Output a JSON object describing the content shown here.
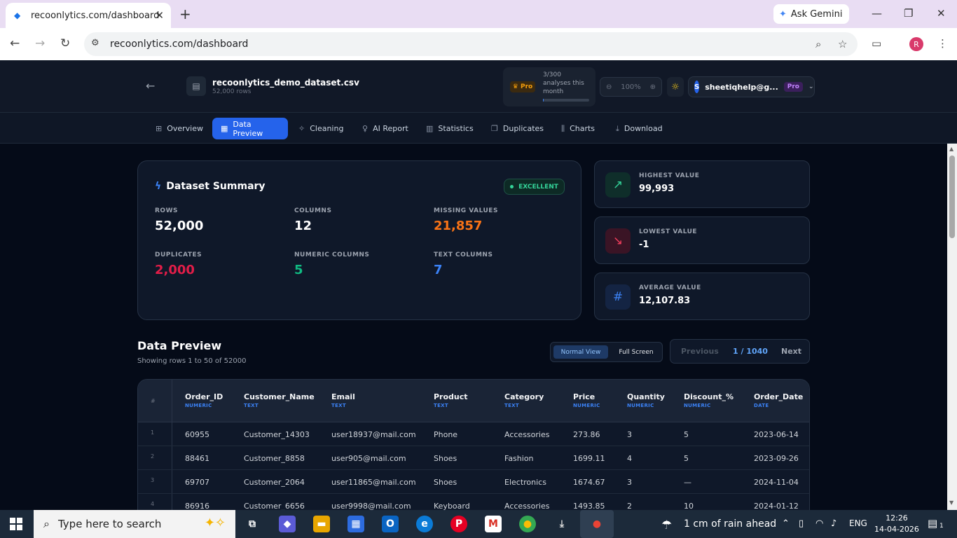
{
  "browser": {
    "tab_title": "recoonlytics.com/dashboard",
    "url": "recoonlytics.com/dashboard",
    "gemini_label": "Ask Gemini",
    "profile_initial": "R"
  },
  "header": {
    "file_name": "recoonlytics_demo_dataset.csv",
    "file_rows": "52,000 rows",
    "pro_badge": "Pro",
    "analyses_text": "3/300 analyses this month",
    "analyses_used_fraction": 0.01,
    "zoom": "100%",
    "user_initial": "S",
    "user_email": "sheetiqhelp@g...",
    "user_plan": "Pro"
  },
  "nav": {
    "tabs": [
      {
        "label": "Overview",
        "icon": "grid-icon"
      },
      {
        "label": "Data Preview",
        "icon": "table-icon",
        "active": true
      },
      {
        "label": "Cleaning",
        "icon": "sparkle-icon"
      },
      {
        "label": "AI Report",
        "icon": "bulb-icon"
      },
      {
        "label": "Statistics",
        "icon": "clipboard-icon"
      },
      {
        "label": "Duplicates",
        "icon": "copy-icon"
      },
      {
        "label": "Charts",
        "icon": "bar-chart-icon"
      },
      {
        "label": "Download",
        "icon": "download-icon"
      }
    ]
  },
  "summary": {
    "title": "Dataset Summary",
    "quality": "EXCELLENT",
    "stats": [
      {
        "label": "ROWS",
        "value": "52,000",
        "color": "#ffffff"
      },
      {
        "label": "COLUMNS",
        "value": "12",
        "color": "#ffffff"
      },
      {
        "label": "MISSING VALUES",
        "value": "21,857",
        "color": "#f97316"
      },
      {
        "label": "DUPLICATES",
        "value": "2,000",
        "color": "#e11d48"
      },
      {
        "label": "NUMERIC COLUMNS",
        "value": "5",
        "color": "#10b981"
      },
      {
        "label": "TEXT COLUMNS",
        "value": "7",
        "color": "#3b82f6"
      }
    ]
  },
  "kpis": [
    {
      "label": "HIGHEST VALUE",
      "value": "99,993",
      "icon": "trend-up-icon",
      "color": "#34d399"
    },
    {
      "label": "LOWEST VALUE",
      "value": "-1",
      "icon": "trend-down-icon",
      "color": "#f43f5e"
    },
    {
      "label": "AVERAGE VALUE",
      "value": "12,107.83",
      "icon": "hash-icon",
      "color": "#3b82f6"
    }
  ],
  "preview": {
    "title": "Data Preview",
    "subtitle": "Showing rows 1 to 50 of 52000",
    "view_normal": "Normal View",
    "view_full": "Full Screen",
    "prev_label": "Previous",
    "page": "1 / 1040",
    "next_label": "Next",
    "row_number_header": "#",
    "columns": [
      {
        "name": "Order_ID",
        "type": "NUMERIC"
      },
      {
        "name": "Customer_Name",
        "type": "TEXT"
      },
      {
        "name": "Email",
        "type": "TEXT"
      },
      {
        "name": "Product",
        "type": "TEXT"
      },
      {
        "name": "Category",
        "type": "TEXT"
      },
      {
        "name": "Price",
        "type": "NUMERIC"
      },
      {
        "name": "Quantity",
        "type": "NUMERIC"
      },
      {
        "name": "Discount_%",
        "type": "NUMERIC"
      },
      {
        "name": "Order_Date",
        "type": "DATE"
      }
    ],
    "rows": [
      {
        "n": "1",
        "cells": [
          "60955",
          "Customer_14303",
          "user18937@mail.com",
          "Phone",
          "Accessories",
          "273.86",
          "3",
          "5",
          "2023-06-14"
        ]
      },
      {
        "n": "2",
        "cells": [
          "88461",
          "Customer_8858",
          "user905@mail.com",
          "Shoes",
          "Fashion",
          "1699.11",
          "4",
          "5",
          "2023-09-26"
        ]
      },
      {
        "n": "3",
        "cells": [
          "69707",
          "Customer_2064",
          "user11865@mail.com",
          "Shoes",
          "Electronics",
          "1674.67",
          "3",
          "—",
          "2024-11-04"
        ]
      },
      {
        "n": "4",
        "cells": [
          "86916",
          "Customer_6656",
          "user9998@mail.com",
          "Keyboard",
          "Accessories",
          "1493.85",
          "2",
          "10",
          "2024-01-12"
        ]
      }
    ]
  },
  "taskbar": {
    "search_placeholder": "Type here to search",
    "weather": "1 cm of rain ahead",
    "language": "ENG",
    "time": "12:26",
    "date": "14-04-2026",
    "notifications": "1"
  }
}
